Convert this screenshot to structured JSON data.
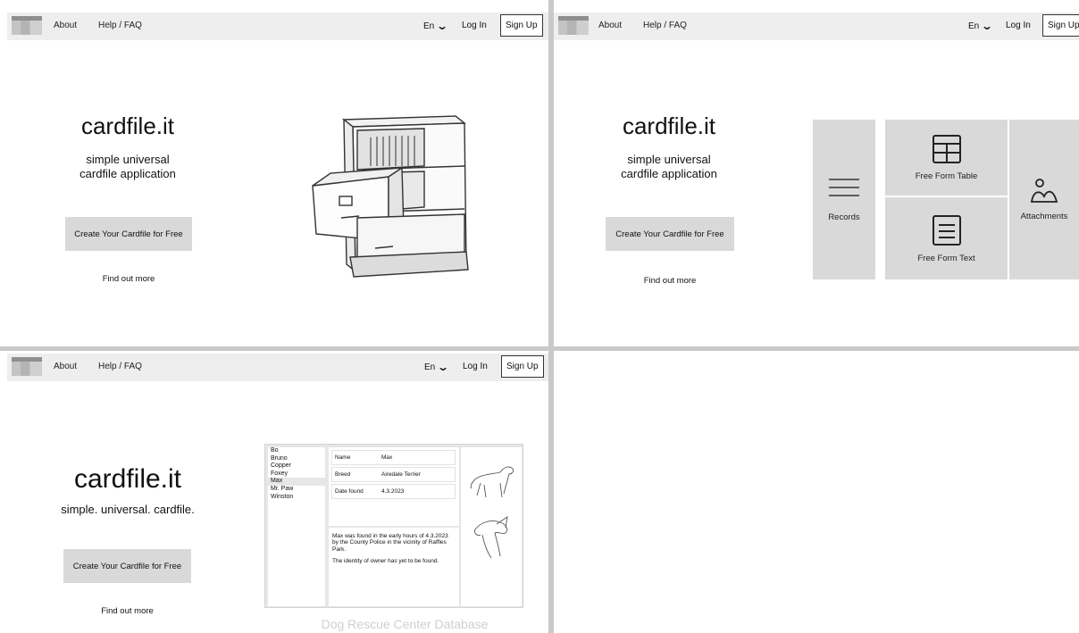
{
  "nav": {
    "about": "About",
    "help": "Help / FAQ",
    "language": "En",
    "login": "Log In",
    "signup": "Sign Up"
  },
  "hero": {
    "title": "cardfile.it",
    "subtitle_line1": "simple universal",
    "subtitle_line2": "cardfile application",
    "tagline": "simple. universal. cardfile.",
    "cta": "Create Your Cardfile for Free",
    "more": "Find out more"
  },
  "features": {
    "records": "Records",
    "table": "Free Form Table",
    "text": "Free Form Text",
    "attachments": "Attachments"
  },
  "demo": {
    "list": [
      "Bo",
      "Bruno",
      "Copper",
      "Foxey",
      "Max",
      "Mr. Paw",
      "Winston"
    ],
    "selected": "Max",
    "fields": [
      {
        "label": "Name",
        "value": "Max"
      },
      {
        "label": "Breed",
        "value": "Airedale Terrier"
      },
      {
        "label": "Date found",
        "value": "4.3.2023"
      }
    ],
    "note1": "Max was found in the early hours of 4.3.2023 by the County Police in the vicinity of Raffles Park.",
    "note2": "The identity of owner has yet to be found.",
    "caption": "Dog Rescue Center Database"
  },
  "icons": {
    "records": "hamburger-list-icon",
    "table": "table-grid-icon",
    "text": "document-text-icon",
    "attachments": "image-attachment-icon"
  }
}
